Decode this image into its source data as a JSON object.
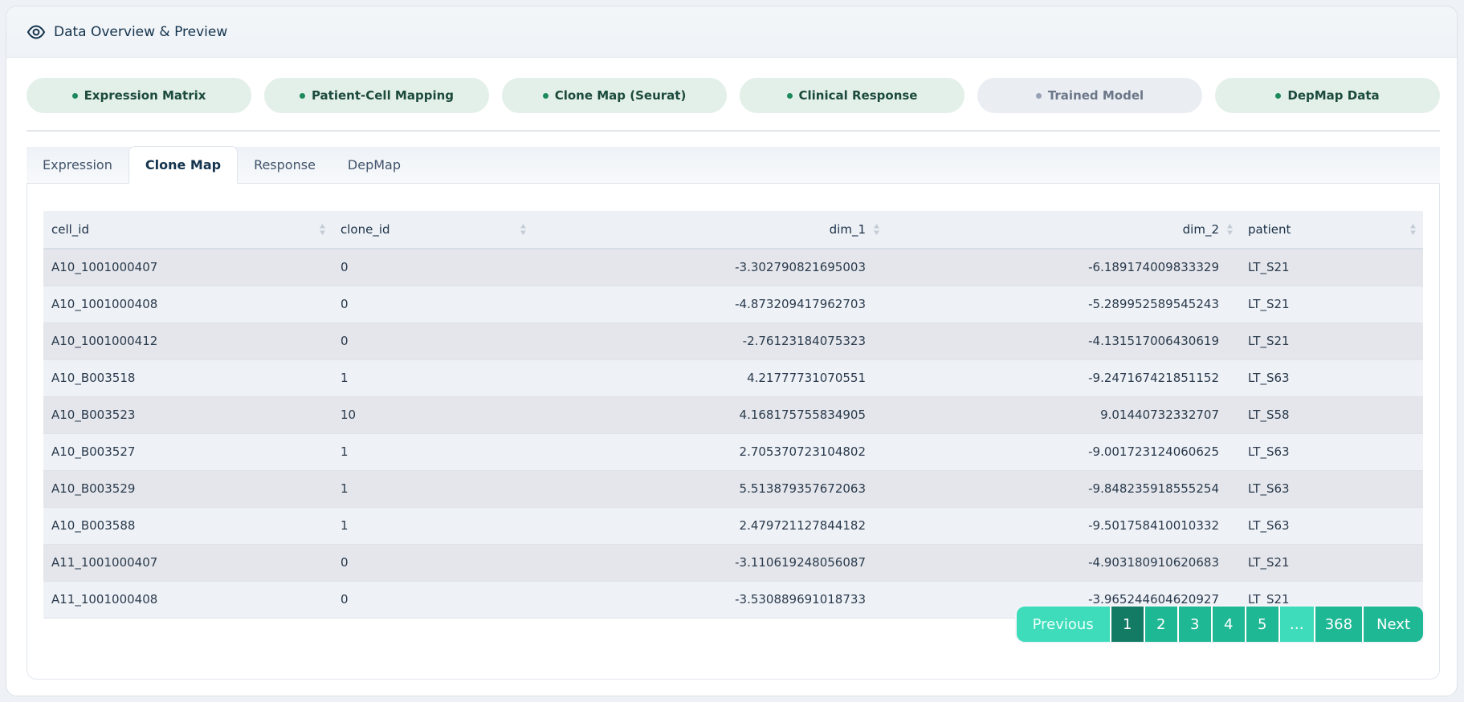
{
  "header": {
    "title": "Data Overview & Preview",
    "icon": "eye-icon"
  },
  "status": [
    {
      "label": "Expression Matrix",
      "active": true
    },
    {
      "label": "Patient-Cell Mapping",
      "active": true
    },
    {
      "label": "Clone Map (Seurat)",
      "active": true
    },
    {
      "label": "Clinical Response",
      "active": true
    },
    {
      "label": "Trained Model",
      "active": false
    },
    {
      "label": "DepMap Data",
      "active": true
    }
  ],
  "tabs": [
    {
      "label": "Expression",
      "active": false
    },
    {
      "label": "Clone Map",
      "active": true
    },
    {
      "label": "Response",
      "active": false
    },
    {
      "label": "DepMap",
      "active": false
    }
  ],
  "table": {
    "columns": [
      "cell_id",
      "clone_id",
      "dim_1",
      "dim_2",
      "patient"
    ],
    "rows": [
      [
        "A10_1001000407",
        "0",
        "-3.302790821695003",
        "-6.189174009833329",
        "LT_S21"
      ],
      [
        "A10_1001000408",
        "0",
        "-4.873209417962703",
        "-5.289952589545243",
        "LT_S21"
      ],
      [
        "A10_1001000412",
        "0",
        "-2.76123184075323",
        "-4.131517006430619",
        "LT_S21"
      ],
      [
        "A10_B003518",
        "1",
        "4.21777731070551",
        "-9.247167421851152",
        "LT_S63"
      ],
      [
        "A10_B003523",
        "10",
        "4.168175755834905",
        "9.01440732332707",
        "LT_S58"
      ],
      [
        "A10_B003527",
        "1",
        "2.705370723104802",
        "-9.001723124060625",
        "LT_S63"
      ],
      [
        "A10_B003529",
        "1",
        "5.513879357672063",
        "-9.848235918555254",
        "LT_S63"
      ],
      [
        "A10_B003588",
        "1",
        "2.479721127844182",
        "-9.501758410010332",
        "LT_S63"
      ],
      [
        "A11_1001000407",
        "0",
        "-3.110619248056087",
        "-4.903180910620683",
        "LT_S21"
      ],
      [
        "A11_1001000408",
        "0",
        "-3.530889691018733",
        "-3.965244604620927",
        "LT_S21"
      ]
    ]
  },
  "pagination": {
    "previous": "Previous",
    "pages": [
      "1",
      "2",
      "3",
      "4",
      "5",
      "…",
      "368"
    ],
    "current": "1",
    "next": "Next"
  },
  "colors": {
    "accent": "#1fb895",
    "accent_dark": "#137a63",
    "status_dot_active": "#1e8a5c",
    "status_dot_inactive": "#96a3b5"
  }
}
